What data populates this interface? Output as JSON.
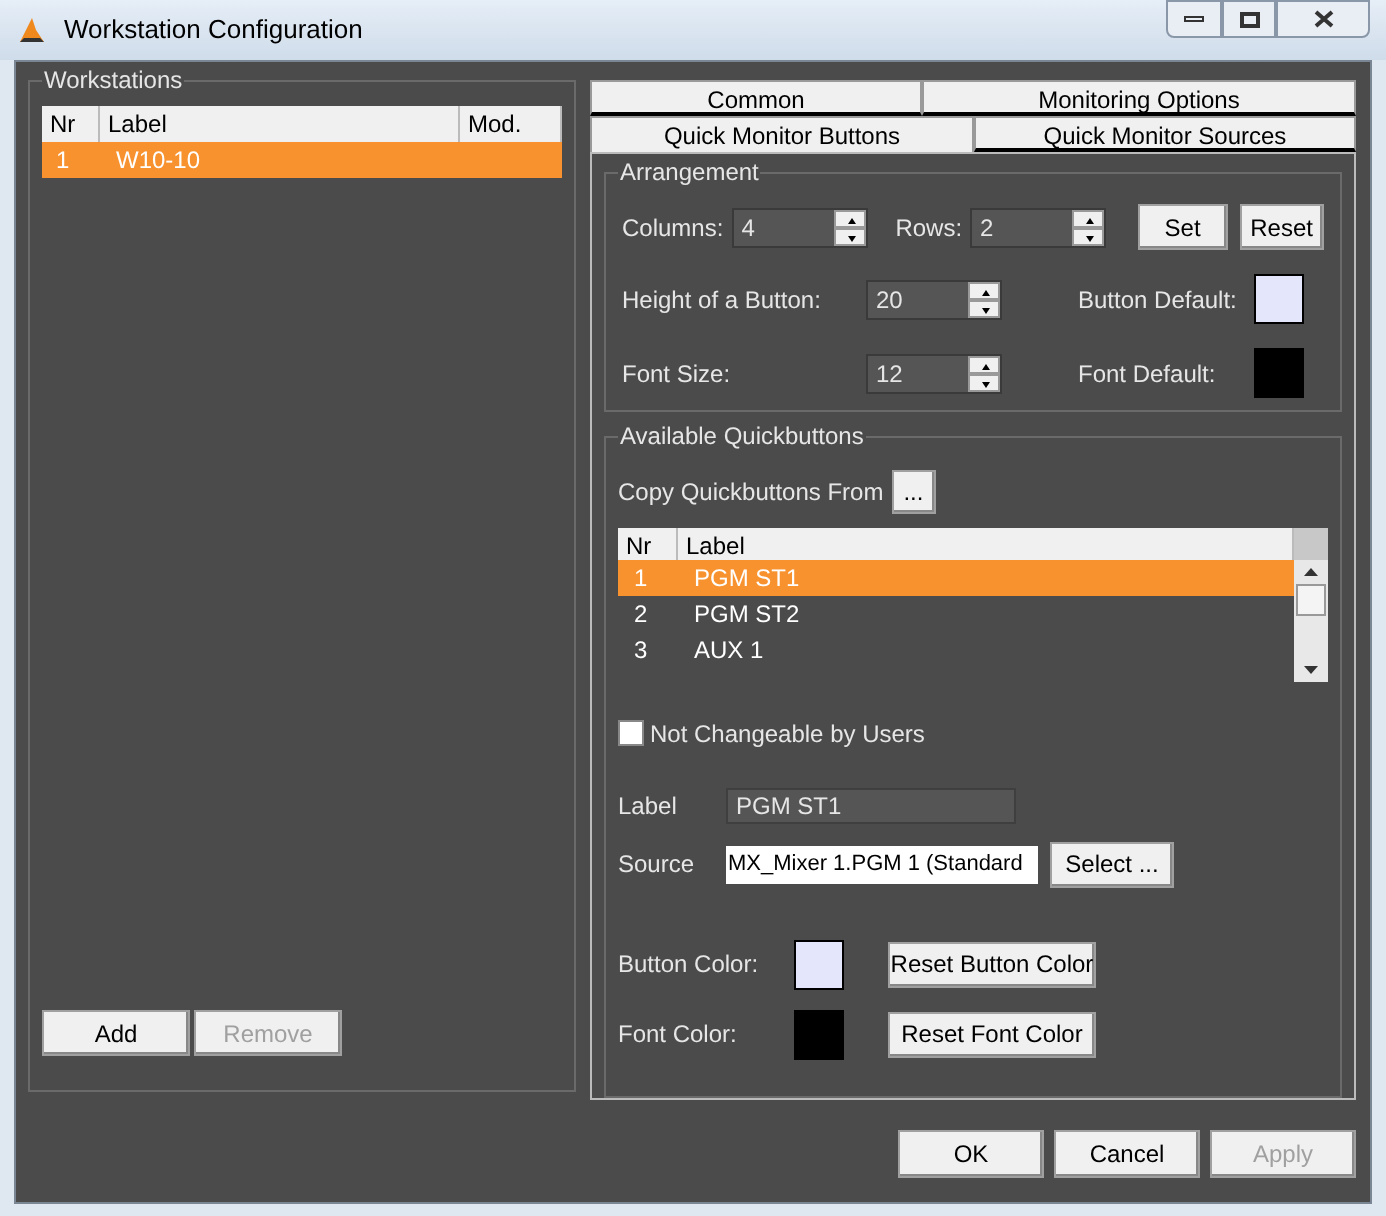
{
  "window": {
    "title": "Workstation Configuration"
  },
  "workstations": {
    "title": "Workstations",
    "columns": [
      "Nr",
      "Label",
      "Mod."
    ],
    "rows": [
      {
        "cells": [
          "1",
          "W10-10",
          ""
        ],
        "selected": true
      }
    ],
    "buttons": [
      {
        "label": "Add",
        "disabled": false
      },
      {
        "label": "Remove",
        "disabled": true
      }
    ]
  },
  "tab_rows": [
    [
      {
        "label": "Common",
        "selected": false
      },
      {
        "label": "Monitoring Options",
        "selected": false
      }
    ],
    [
      {
        "label": "Quick Monitor Buttons",
        "selected": true
      },
      {
        "label": "Quick Monitor Sources",
        "selected": false
      }
    ]
  ],
  "arrangement": {
    "title": "Arrangement",
    "columns": {
      "label": "Columns:",
      "value": "4"
    },
    "rows": {
      "label": "Rows:",
      "value": "2"
    },
    "set_button": "Set",
    "reset_button": "Reset",
    "height": {
      "label": "Height of a Button:",
      "value": "20"
    },
    "font_size": {
      "label": "Font Size:",
      "value": "12"
    },
    "button_default": {
      "label": "Button Default:",
      "color": "#e4e6fc"
    },
    "font_default": {
      "label": "Font Default:",
      "color": "#000000"
    }
  },
  "quickbuttons": {
    "title": "Available Quickbuttons",
    "copy_label": "Copy Quickbuttons From",
    "copy_button": "...",
    "columns": [
      "Nr",
      "Label"
    ],
    "rows": [
      {
        "cells": [
          "1",
          "PGM ST1"
        ],
        "selected": true
      },
      {
        "cells": [
          "2",
          "PGM ST2"
        ],
        "selected": false
      },
      {
        "cells": [
          "3",
          "AUX 1"
        ],
        "selected": false
      }
    ],
    "not_changeable": {
      "label": "Not Changeable by Users",
      "checked": false
    },
    "label_field": {
      "label": "Label",
      "value": "PGM ST1"
    },
    "source_field": {
      "label": "Source",
      "value": "MX_Mixer 1.PGM 1 (Standard"
    },
    "select_button": "Select ...",
    "button_color": {
      "label": "Button Color:",
      "color": "#e4e6fc",
      "reset": "Reset Button Color"
    },
    "font_color": {
      "label": "Font Color:",
      "color": "#000000",
      "reset": "Reset Font Color"
    }
  },
  "footer_buttons": [
    {
      "label": "OK",
      "disabled": false
    },
    {
      "label": "Cancel",
      "disabled": false
    },
    {
      "label": "Apply",
      "disabled": true
    }
  ]
}
